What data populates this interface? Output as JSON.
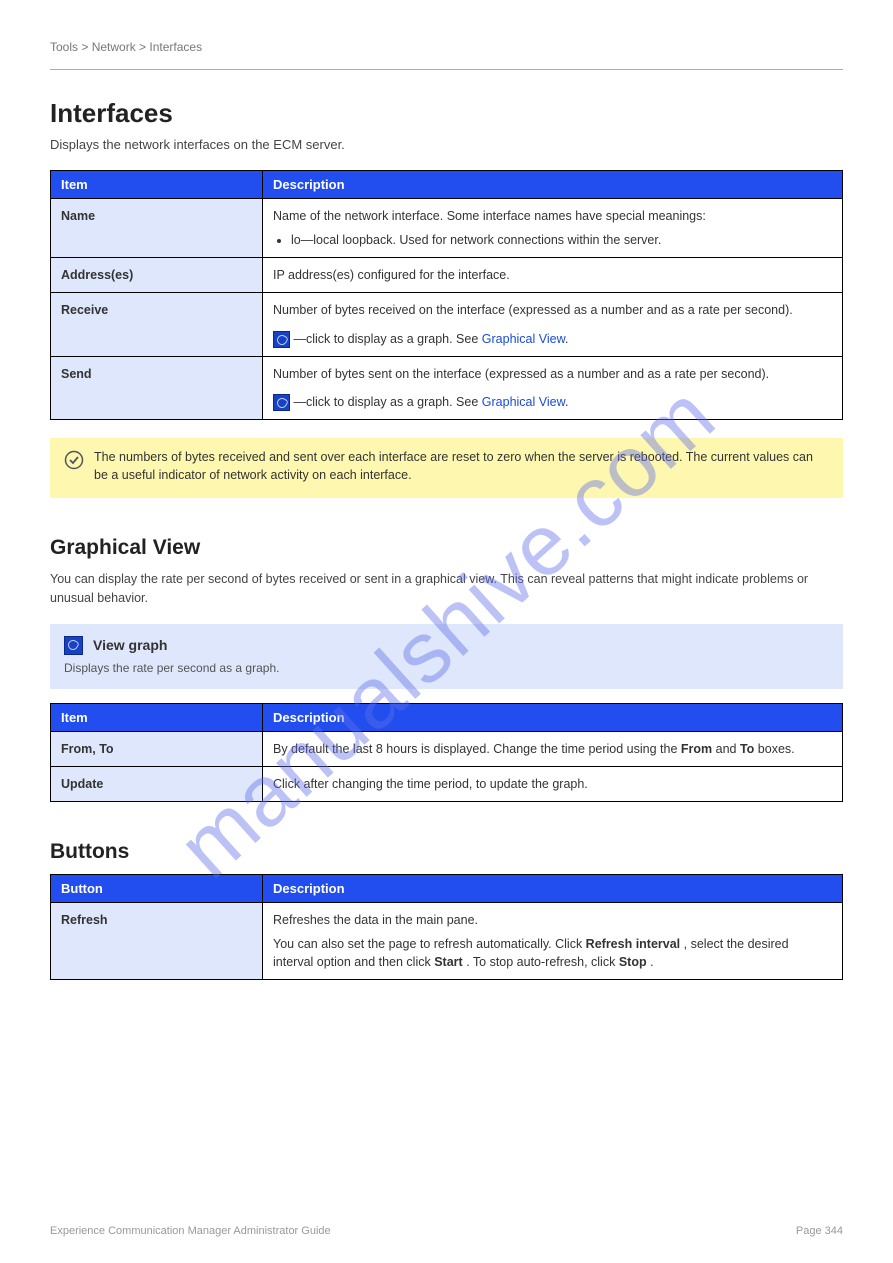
{
  "watermark": "manualshive.com",
  "header": {
    "breadcrumb": "Tools > Network > Interfaces"
  },
  "title": "Interfaces",
  "subtitle": "Displays the network interfaces on the ECM server.",
  "table1": {
    "headers": [
      "Item",
      "Description"
    ],
    "rows": [
      {
        "item": "Name",
        "desc": "Name of the network interface. Some interface names have special meanings:",
        "sublist": [
          "lo—local loopback. Used for network connections within the server."
        ]
      },
      {
        "item": "Address(es)",
        "desc": "IP address(es) configured for the interface."
      },
      {
        "item": "Receive",
        "desc_parts": {
          "line1": "Number of bytes received on the interface (expressed as a number and as a rate per second).",
          "icon_suffix": " —click to display as a graph. See "
        },
        "link": "Graphical View"
      },
      {
        "item": "Send",
        "desc_parts": {
          "line1": "Number of bytes sent on the interface (expressed as a number and as a rate per second).",
          "icon_suffix": " —click to display as a graph. See "
        },
        "link": "Graphical View"
      }
    ]
  },
  "note": {
    "text": "The numbers of bytes received and sent over each interface are reset to zero when the server is rebooted. The current values can be a useful indicator of network activity on each interface."
  },
  "section2": {
    "heading": "Graphical View",
    "desc": "You can display the rate per second of bytes received or sent in a graphical view. This can reveal patterns that might indicate problems or unusual behavior.",
    "icon_label": "View graph",
    "icon_desc": "Displays the rate per second as a graph.",
    "table": {
      "headers": [
        "Item",
        "Description"
      ],
      "rows": [
        {
          "item": "From, To",
          "desc_parts": {
            "pre": "By default the last 8 hours is displayed. Change the time period using the ",
            "bold1": "From",
            "mid": " and ",
            "bold2": "To",
            "post": " boxes."
          }
        },
        {
          "item": "Update",
          "desc": "Click after changing the time period, to update the graph."
        }
      ]
    }
  },
  "section3": {
    "heading": "Buttons",
    "table": {
      "headers": [
        "Button",
        "Description"
      ],
      "rows": [
        {
          "item": "Refresh",
          "desc_parts": {
            "p1": "Refreshes the data in the main pane.",
            "p2_pre": "You can also set the page to refresh automatically. Click ",
            "p2_bold1": "Refresh interval",
            "p2_mid": ", select the desired interval option and then click ",
            "p2_bold2": "Start",
            "p2_mid2": ". To stop auto-refresh, click ",
            "p2_bold3": "Stop",
            "p2_post": "."
          }
        }
      ]
    }
  },
  "footer": {
    "left": "Experience Communication Manager Administrator Guide",
    "right": "Page 344"
  }
}
